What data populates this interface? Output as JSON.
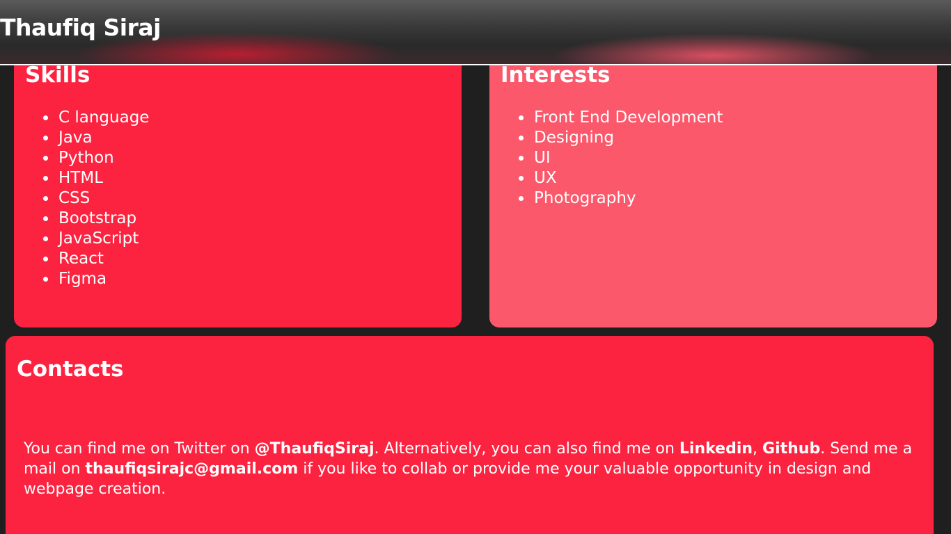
{
  "header": {
    "title": "Thaufiq Siraj"
  },
  "skills": {
    "heading": "Skills",
    "items": [
      "C language",
      "Java",
      "Python",
      "HTML",
      "CSS",
      "Bootstrap",
      "JavaScript",
      "React",
      "Figma"
    ]
  },
  "interests": {
    "heading": "Interests",
    "items": [
      "Front End Development",
      "Designing",
      "UI",
      "UX",
      "Photography"
    ]
  },
  "contacts": {
    "heading": "Contacts",
    "text_1": "You can find me on Twitter on ",
    "twitter": "@ThaufiqSiraj",
    "text_2": ". Alternatively, you can also find me on ",
    "linkedin": "Linkedin",
    "text_3": ", ",
    "github": "Github",
    "text_4": ". Send me a mail on ",
    "email": "thaufiqsirajc@gmail.com",
    "text_5": " if you like to collab or provide me your valuable opportunity in design and webpage creation."
  },
  "colors": {
    "background": "#1f1f1f",
    "skills_card": "#fc2340",
    "interests_card": "#fb586b",
    "contacts_card": "#fc2340",
    "text": "#ffffff"
  }
}
